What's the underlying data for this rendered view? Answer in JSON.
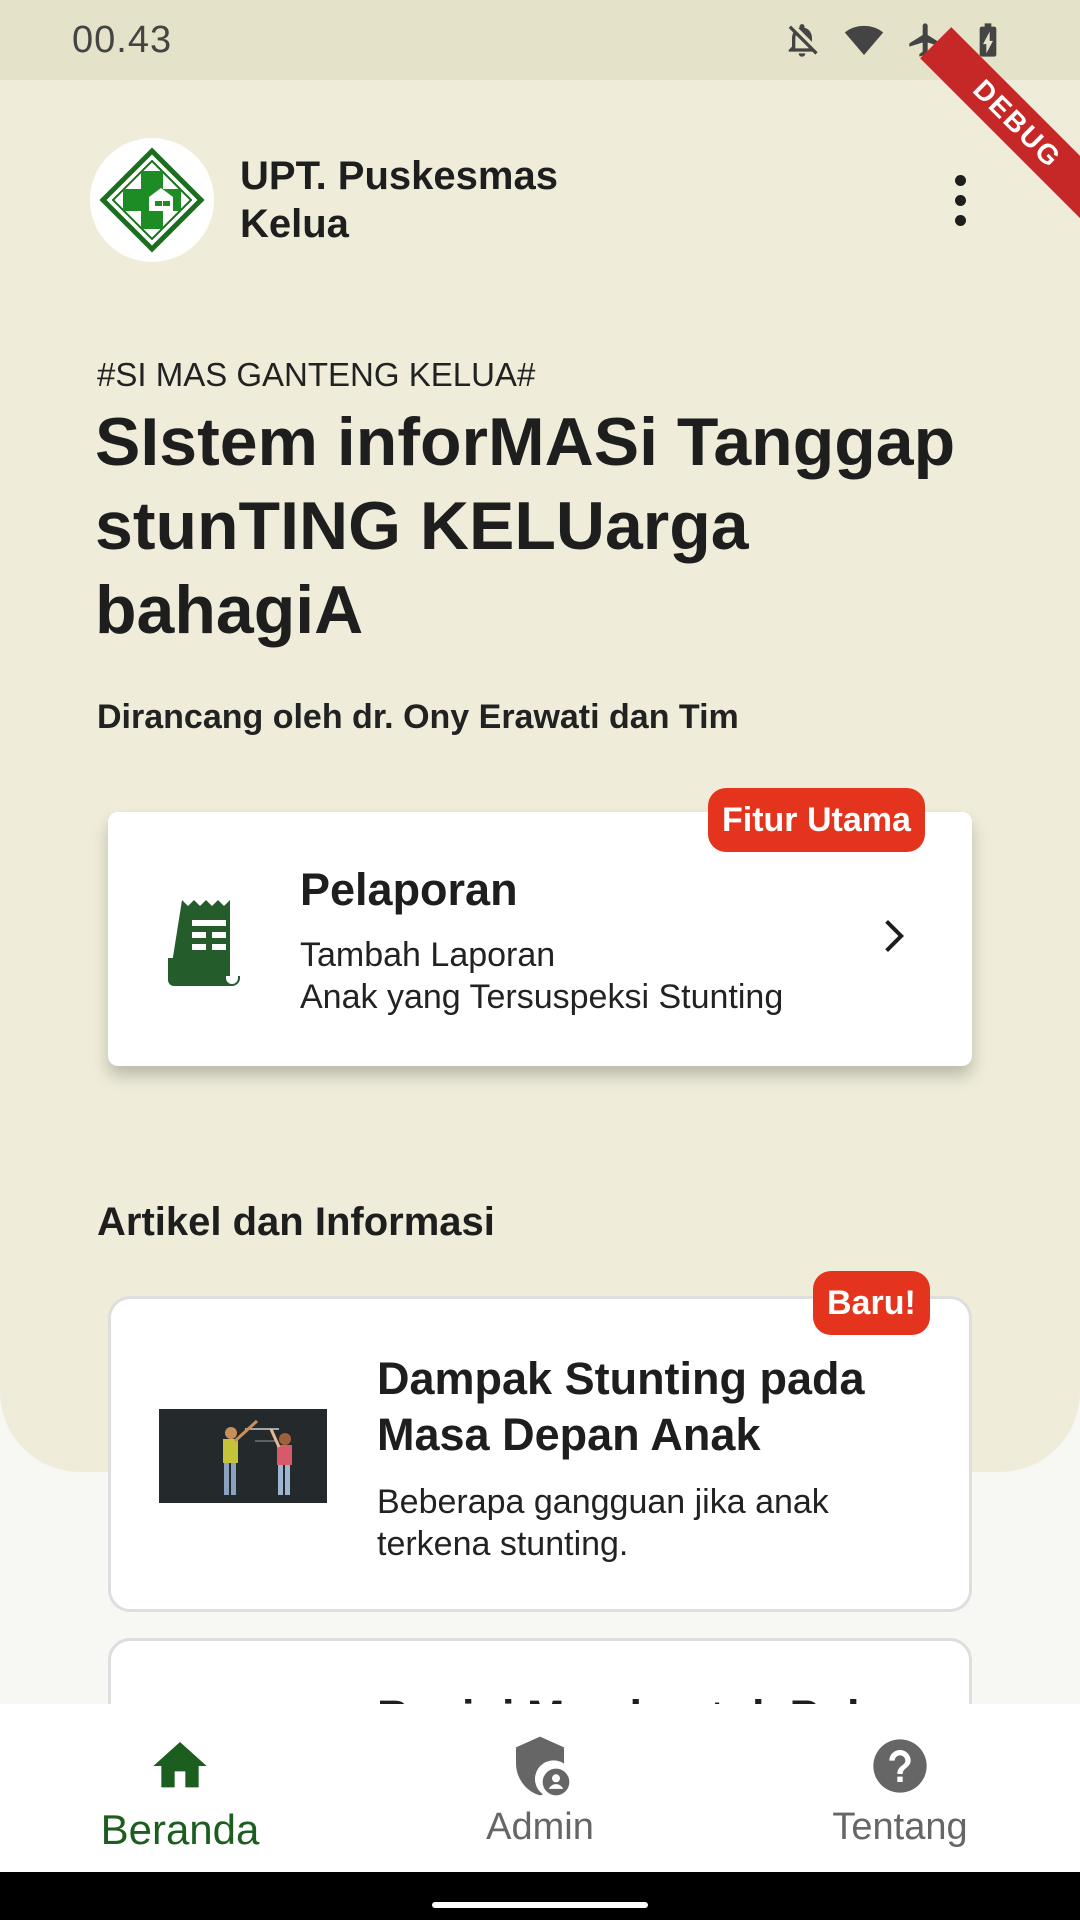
{
  "status_bar": {
    "time": "00.43"
  },
  "debug_ribbon": "DEBUG",
  "app_bar": {
    "title": "UPT. Puskesmas Kelua"
  },
  "hero": {
    "tagline": "#SI MAS GANTENG KELUA#",
    "headline": "SIstem inforMASi Tanggap stunTING KELUarga bahagiA",
    "credit": "Dirancang oleh dr. Ony Erawati dan Tim"
  },
  "report_card": {
    "badge": "Fitur Utama",
    "title": "Pelaporan",
    "subtitle_line1": "Tambah Laporan",
    "subtitle_line2": "Anak yang Tersuspeksi Stunting"
  },
  "articles_section": {
    "title": "Artikel dan Informasi",
    "items": [
      {
        "badge": "Baru!",
        "title": "Dampak Stunting pada Masa Depan Anak",
        "description": "Beberapa gangguan jika anak terkena stunting."
      },
      {
        "title": "Begini Membentuk Pola"
      }
    ]
  },
  "bottom_nav": {
    "items": [
      {
        "label": "Beranda",
        "icon": "home-icon",
        "active": true
      },
      {
        "label": "Admin",
        "icon": "admin-shield-icon",
        "active": false
      },
      {
        "label": "Tentang",
        "icon": "help-icon",
        "active": false
      }
    ]
  },
  "colors": {
    "hero_bg": "#efedd9",
    "accent_green": "#1b5e20",
    "badge_red": "#e5341d"
  }
}
